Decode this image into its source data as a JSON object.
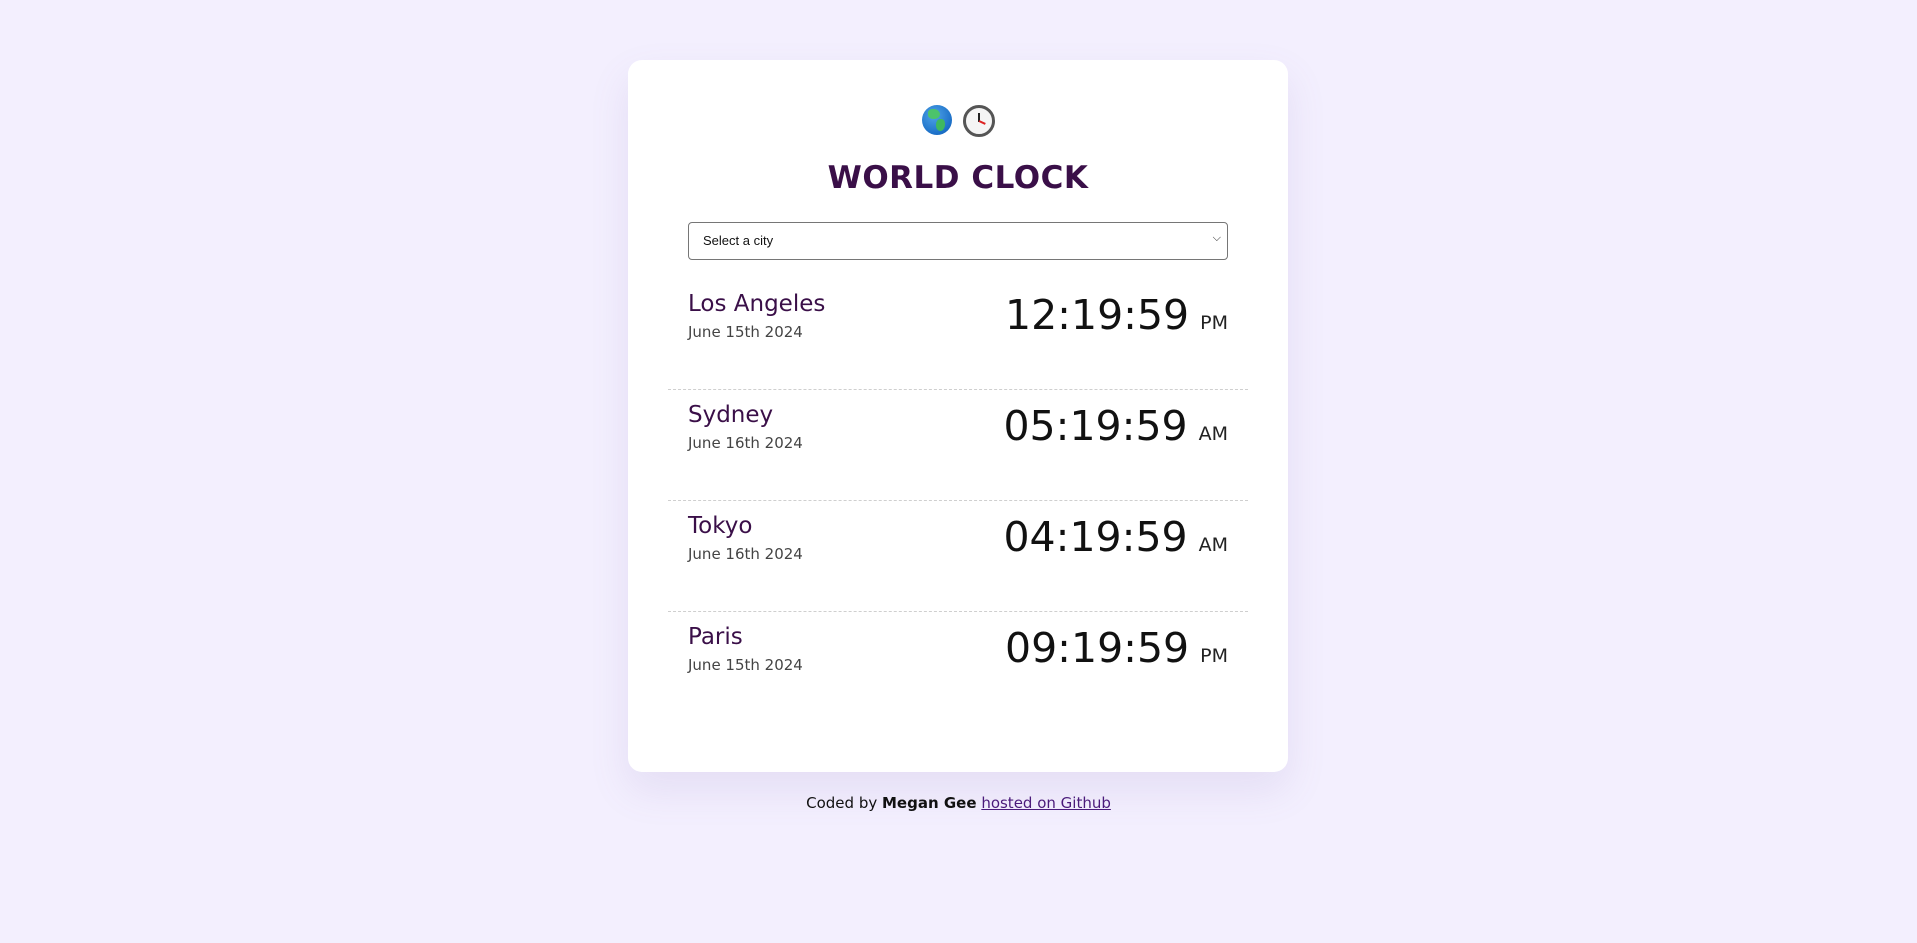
{
  "header": {
    "icons": [
      "globe-icon",
      "clock-icon"
    ],
    "title": "WORLD CLOCK"
  },
  "select": {
    "selected": "Select a city"
  },
  "cities": [
    {
      "name": "Los Angeles",
      "date": "June 15th 2024",
      "time": "12:19:59",
      "ampm": "PM"
    },
    {
      "name": "Sydney",
      "date": "June 16th 2024",
      "time": "05:19:59",
      "ampm": "AM"
    },
    {
      "name": "Tokyo",
      "date": "June 16th 2024",
      "time": "04:19:59",
      "ampm": "AM"
    },
    {
      "name": "Paris",
      "date": "June 15th 2024",
      "time": "09:19:59",
      "ampm": "PM"
    }
  ],
  "footer": {
    "prefix": "Coded by",
    "author": "Megan Gee",
    "link_text": "hosted on Github"
  },
  "colors": {
    "background": "#f3effe",
    "title": "#3a0f48",
    "link": "#4a1a7a"
  }
}
